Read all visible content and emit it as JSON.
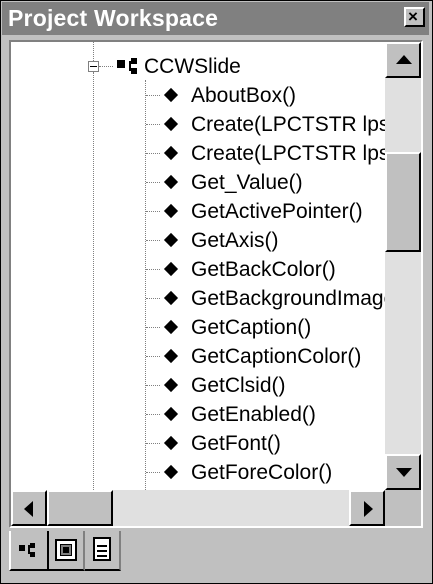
{
  "window": {
    "title": "Project Workspace",
    "close_glyph": "×"
  },
  "tree": {
    "root_node": "CCWSlide",
    "root_state": "expanded",
    "members": [
      "AboutBox()",
      "Create(LPCTSTR lpsz",
      "Create(LPCTSTR lpsz",
      "Get_Value()",
      "GetActivePointer()",
      "GetAxis()",
      "GetBackColor()",
      "GetBackgroundImage",
      "GetCaption()",
      "GetCaptionColor()",
      "GetClsid()",
      "GetEnabled()",
      "GetFont()",
      "GetForeColor()"
    ],
    "member_icon": "diamond-method-icon",
    "class_icon": "class-icon"
  },
  "scrollbars": {
    "vertical_position": 0.28,
    "horizontal_position": 0.05
  },
  "tabs": [
    {
      "icon": "classview-tab-icon",
      "active": true
    },
    {
      "icon": "resourceview-tab-icon",
      "active": false
    },
    {
      "icon": "fileview-tab-icon",
      "active": false
    }
  ],
  "colors": {
    "titlebar": "#808080",
    "face": "#c0c0c0",
    "window": "#ffffff"
  }
}
